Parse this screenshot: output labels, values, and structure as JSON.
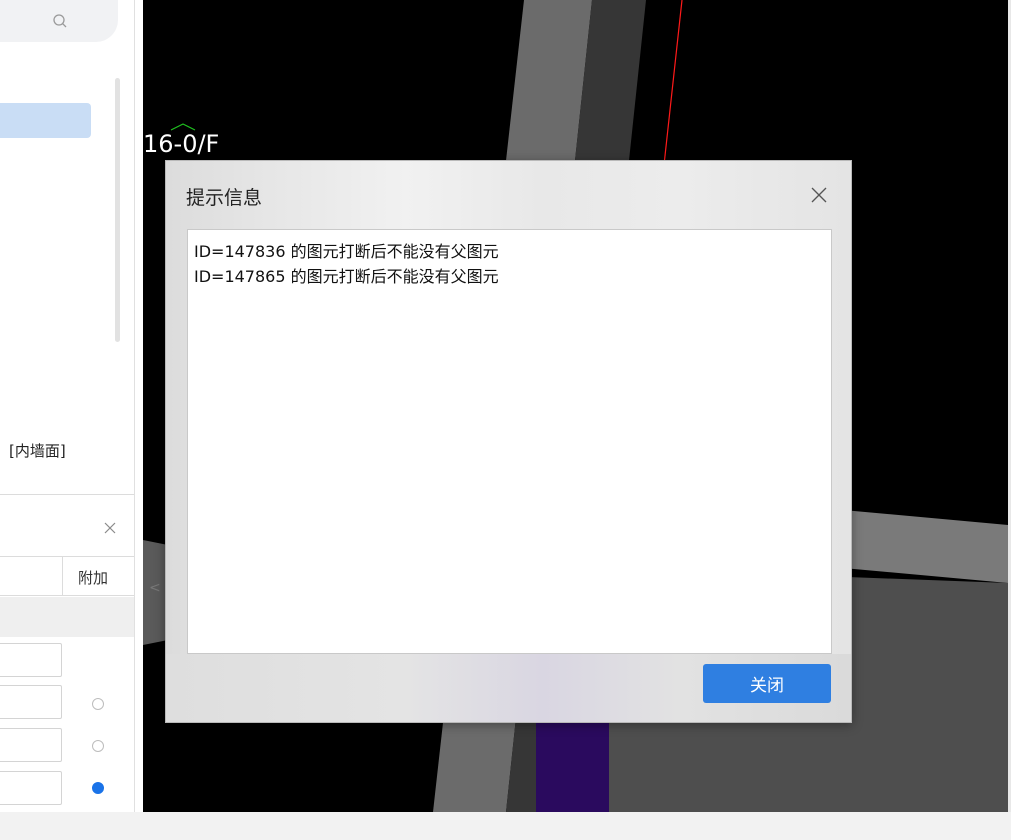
{
  "left_panel": {
    "wall_face_label": "[内墙面]",
    "props_extra_column_header": "附加",
    "rows": [
      {
        "radio_checked": false,
        "has_radio": false
      },
      {
        "radio_checked": false,
        "has_radio": true
      },
      {
        "radio_checked": false,
        "has_radio": true
      },
      {
        "radio_checked": true,
        "has_radio": true
      }
    ]
  },
  "viewport": {
    "label": "16-0/F",
    "collapse_arrow": "<"
  },
  "dialog": {
    "title": "提示信息",
    "messages": [
      "ID=147836 的图元打断后不能没有父图元",
      "ID=147865 的图元打断后不能没有父图元"
    ],
    "close_button_label": "关闭"
  },
  "colors": {
    "accent": "#2f7fe1",
    "selection": "#c9ddf5",
    "viewport_bg": "#000000",
    "wall_purple": "#2a0a5e",
    "axis_red": "#ff1a1a",
    "marker_green": "#1fbf1f"
  }
}
